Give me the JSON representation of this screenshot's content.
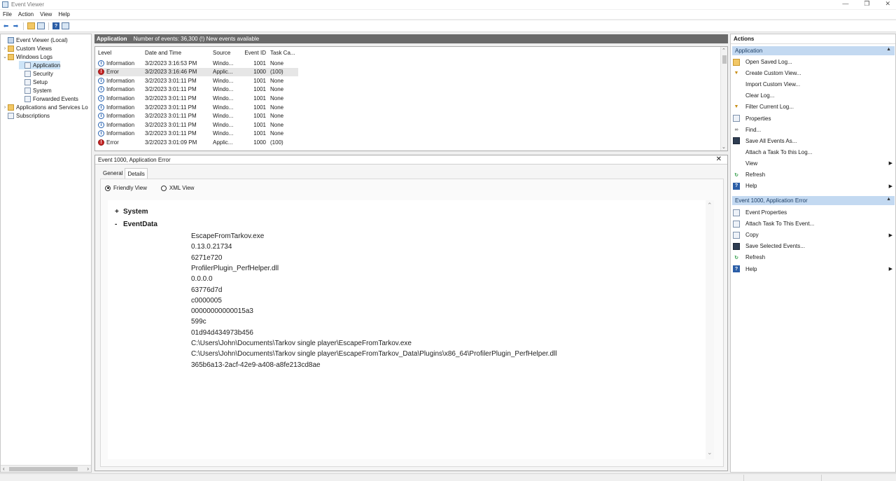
{
  "window": {
    "title": "Event Viewer",
    "controls": [
      "—",
      "❐",
      "✕"
    ]
  },
  "menu": [
    "File",
    "Action",
    "View",
    "Help"
  ],
  "toolbar": {
    "icons": [
      "back-arrow-icon",
      "forward-arrow-icon",
      "folder-up-icon",
      "console-tree-icon",
      "help-icon",
      "panel-icon"
    ]
  },
  "tree": {
    "items": [
      {
        "label": "Event Viewer (Local)",
        "exp": "",
        "icon": "root",
        "indent": 0
      },
      {
        "label": "Custom Views",
        "exp": "›",
        "icon": "folder",
        "indent": 0
      },
      {
        "label": "Windows Logs",
        "exp": "⌄",
        "icon": "folder",
        "indent": 0
      },
      {
        "label": "Application",
        "exp": "",
        "icon": "log",
        "indent": 1,
        "selected": true
      },
      {
        "label": "Security",
        "exp": "",
        "icon": "log",
        "indent": 1
      },
      {
        "label": "Setup",
        "exp": "",
        "icon": "log",
        "indent": 1
      },
      {
        "label": "System",
        "exp": "",
        "icon": "log",
        "indent": 1
      },
      {
        "label": "Forwarded Events",
        "exp": "",
        "icon": "log",
        "indent": 1
      },
      {
        "label": "Applications and Services Lo",
        "exp": "›",
        "icon": "folder",
        "indent": 0
      },
      {
        "label": "Subscriptions",
        "exp": "",
        "icon": "log",
        "indent": 0
      }
    ]
  },
  "log_header": {
    "name": "Application",
    "info": "Number of events: 36,300 (!) New events available"
  },
  "event_list": {
    "columns": [
      "Level",
      "Date and Time",
      "Source",
      "Event ID",
      "Task Ca..."
    ],
    "rows": [
      {
        "level": "Information",
        "date": "3/2/2023 3:16:53 PM",
        "source": "Windo...",
        "id": "1001",
        "task": "None",
        "type": "info"
      },
      {
        "level": "Error",
        "date": "3/2/2023 3:16:46 PM",
        "source": "Applic...",
        "id": "1000",
        "task": "(100)",
        "type": "err",
        "selected": true
      },
      {
        "level": "Information",
        "date": "3/2/2023 3:01:11 PM",
        "source": "Windo...",
        "id": "1001",
        "task": "None",
        "type": "info"
      },
      {
        "level": "Information",
        "date": "3/2/2023 3:01:11 PM",
        "source": "Windo...",
        "id": "1001",
        "task": "None",
        "type": "info"
      },
      {
        "level": "Information",
        "date": "3/2/2023 3:01:11 PM",
        "source": "Windo...",
        "id": "1001",
        "task": "None",
        "type": "info"
      },
      {
        "level": "Information",
        "date": "3/2/2023 3:01:11 PM",
        "source": "Windo...",
        "id": "1001",
        "task": "None",
        "type": "info"
      },
      {
        "level": "Information",
        "date": "3/2/2023 3:01:11 PM",
        "source": "Windo...",
        "id": "1001",
        "task": "None",
        "type": "info"
      },
      {
        "level": "Information",
        "date": "3/2/2023 3:01:11 PM",
        "source": "Windo...",
        "id": "1001",
        "task": "None",
        "type": "info"
      },
      {
        "level": "Information",
        "date": "3/2/2023 3:01:11 PM",
        "source": "Windo...",
        "id": "1001",
        "task": "None",
        "type": "info"
      },
      {
        "level": "Error",
        "date": "3/2/2023 3:01:09 PM",
        "source": "Applic...",
        "id": "1000",
        "task": "(100)",
        "type": "err"
      }
    ]
  },
  "detail": {
    "title": "Event 1000, Application Error",
    "close": "✕",
    "tabs": [
      "General",
      "Details"
    ],
    "radio_friendly": "Friendly View",
    "radio_xml": "XML View",
    "system_label": "System",
    "system_sym": "+",
    "eventdata_label": "EventData",
    "eventdata_sym": "-",
    "event_data": [
      "EscapeFromTarkov.exe",
      "0.13.0.21734",
      "6271e720",
      "ProfilerPlugin_PerfHelper.dll",
      "0.0.0.0",
      "63776d7d",
      "c0000005",
      "00000000000015a3",
      "599c",
      "01d94d434973b456",
      "C:\\Users\\John\\Documents\\Tarkov single player\\EscapeFromTarkov.exe",
      "C:\\Users\\John\\Documents\\Tarkov single player\\EscapeFromTarkov_Data\\Plugins\\x86_64\\ProfilerPlugin_PerfHelper.dll",
      "365b6a13-2acf-42e9-a408-a8fe213cd8ae"
    ]
  },
  "actions": {
    "title": "Actions",
    "group1": "Application",
    "group1_items": [
      {
        "label": "Open Saved Log...",
        "icon": "folder",
        "sub": false
      },
      {
        "label": "Create Custom View...",
        "icon": "filter",
        "sub": false
      },
      {
        "label": "Import Custom View...",
        "icon": "none",
        "sub": false
      },
      {
        "label": "Clear Log...",
        "icon": "none",
        "sub": false
      },
      {
        "label": "Filter Current Log...",
        "icon": "filter",
        "sub": false
      },
      {
        "label": "Properties",
        "icon": "doc",
        "sub": false
      },
      {
        "label": "Find...",
        "icon": "find",
        "sub": false
      },
      {
        "label": "Save All Events As...",
        "icon": "save",
        "sub": false
      },
      {
        "label": "Attach a Task To this Log...",
        "icon": "none",
        "sub": false
      },
      {
        "label": "View",
        "icon": "none",
        "sub": true
      },
      {
        "label": "Refresh",
        "icon": "refresh",
        "sub": false
      },
      {
        "label": "Help",
        "icon": "help",
        "sub": true
      }
    ],
    "group2": "Event 1000, Application Error",
    "group2_items": [
      {
        "label": "Event Properties",
        "icon": "doc",
        "sub": false
      },
      {
        "label": "Attach Task To This Event...",
        "icon": "doc",
        "sub": false
      },
      {
        "label": "Copy",
        "icon": "doc",
        "sub": true
      },
      {
        "label": "Save Selected Events...",
        "icon": "save",
        "sub": false
      },
      {
        "label": "Refresh",
        "icon": "refresh",
        "sub": false
      },
      {
        "label": "Help",
        "icon": "help",
        "sub": true
      }
    ]
  }
}
